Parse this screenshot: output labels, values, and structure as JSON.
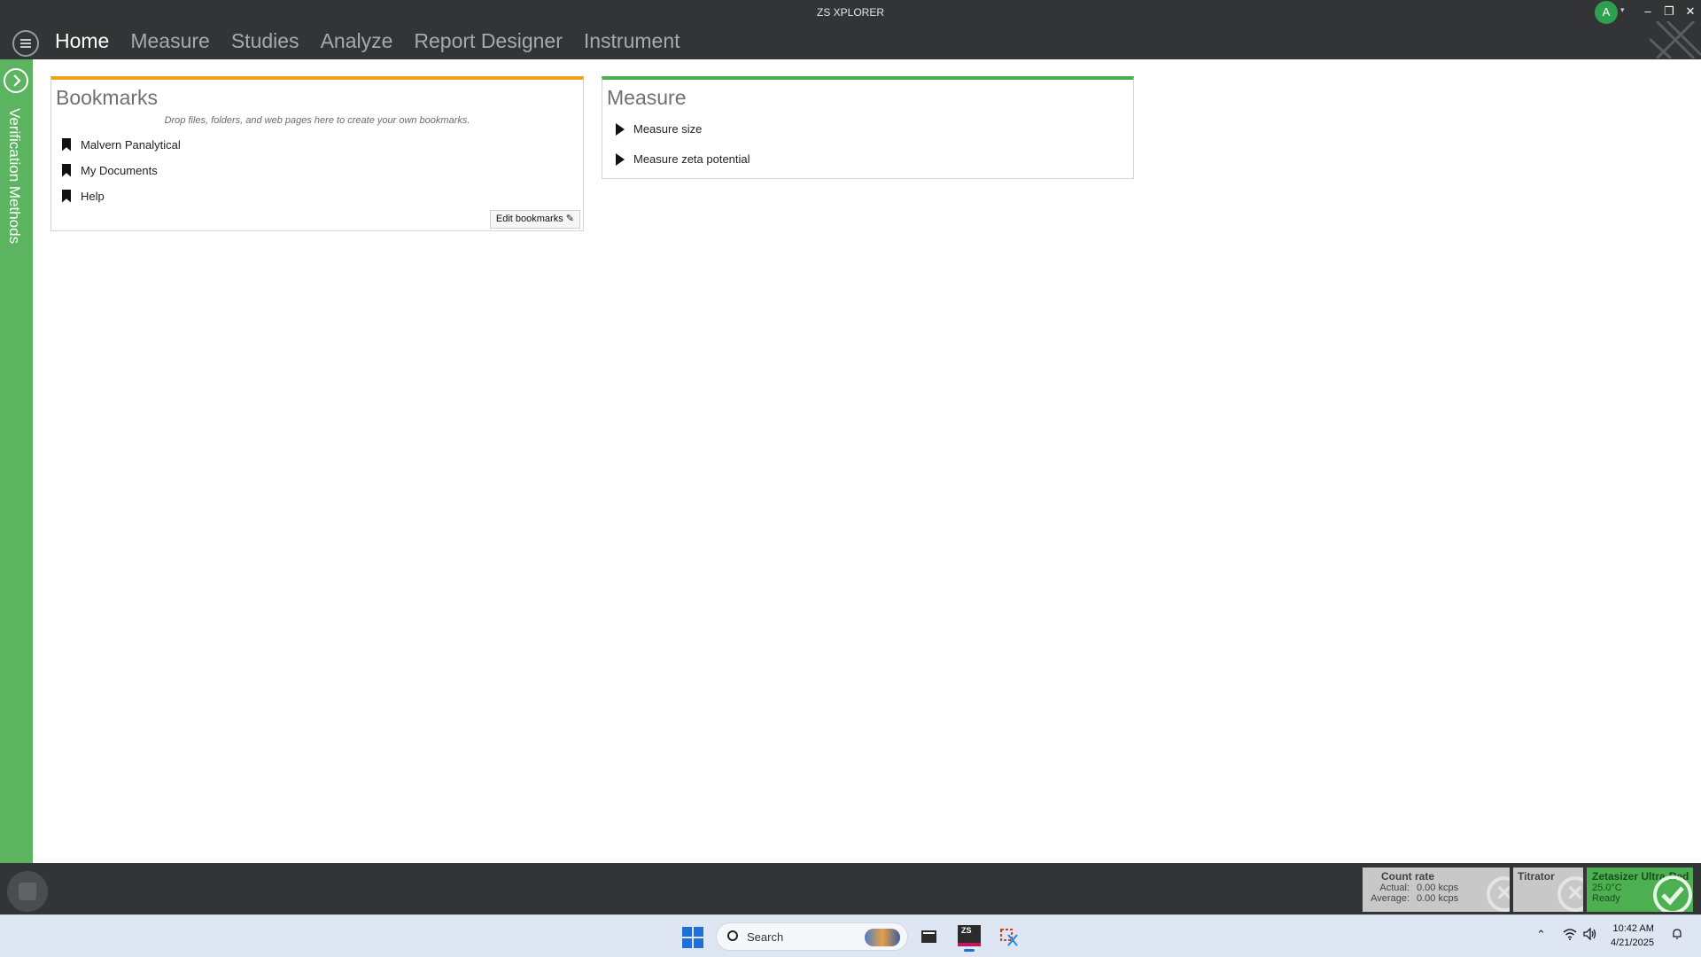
{
  "window": {
    "title": "ZS XPLORER",
    "user_initial": "A",
    "controls": {
      "minimize": "–",
      "maximize": "❐",
      "close": "✕"
    }
  },
  "nav": {
    "tabs": [
      {
        "label": "Home",
        "active": true
      },
      {
        "label": "Measure",
        "active": false
      },
      {
        "label": "Studies",
        "active": false
      },
      {
        "label": "Analyze",
        "active": false
      },
      {
        "label": "Report Designer",
        "active": false
      },
      {
        "label": "Instrument",
        "active": false
      }
    ]
  },
  "rail": {
    "label": "Verification Methods"
  },
  "bookmarks": {
    "title": "Bookmarks",
    "hint": "Drop files, folders, and web pages here to create your own bookmarks.",
    "items": [
      "Malvern Panalytical",
      "My Documents",
      "Help"
    ],
    "edit_label": "Edit bookmarks"
  },
  "measure": {
    "title": "Measure",
    "items": [
      "Measure size",
      "Measure zeta potential"
    ]
  },
  "status": {
    "count_rate": {
      "title": "Count rate",
      "actual_label": "Actual:",
      "actual_value": "0.00 kcps",
      "average_label": "Average:",
      "average_value": "0.00 kcps"
    },
    "titrator": {
      "title": "Titrator"
    },
    "instrument": {
      "title": "Zetasizer Ultra-Red",
      "temperature": "25.0°C",
      "state": "Ready"
    }
  },
  "taskbar": {
    "search_placeholder": "Search",
    "app_label": "ZS",
    "time": "10:42 AM",
    "date": "4/21/2025"
  },
  "colors": {
    "title_bar": "#323435",
    "rail_green": "#5cb460",
    "bookmarks_accent": "#f0a01e",
    "measure_accent": "#4caf50"
  }
}
